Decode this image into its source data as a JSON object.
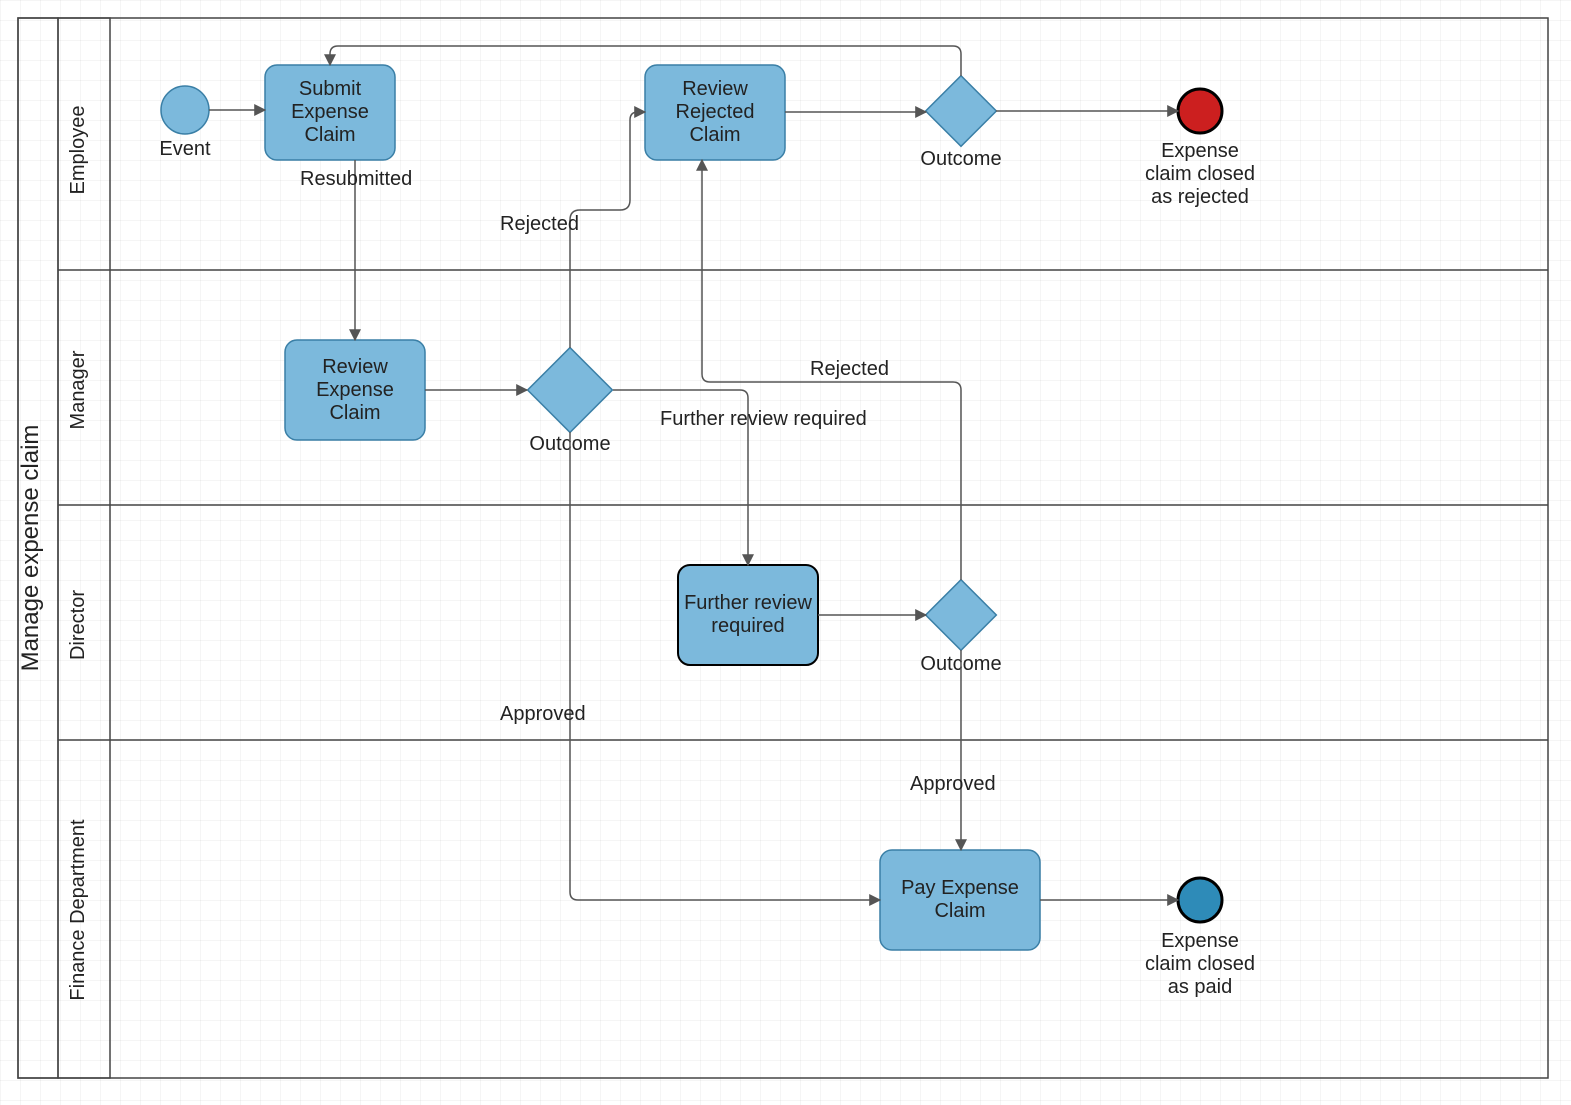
{
  "pool": {
    "title": "Manage expense claim"
  },
  "lanes": {
    "employee": "Employee",
    "manager": "Manager",
    "director": "Director",
    "finance": "Finance Department"
  },
  "nodes": {
    "start_label": "Event",
    "submit_claim": "Submit Expense Claim",
    "review_rejected": "Review Rejected Claim",
    "gw_employee_label": "Outcome",
    "end_rejected_label": "Expense claim closed as rejected",
    "review_claim": "Review Expense Claim",
    "gw_manager_label": "Outcome",
    "further_review": "Further review required",
    "gw_director_label": "Outcome",
    "pay_claim": "Pay Expense Claim",
    "end_paid_label": "Expense claim closed as paid"
  },
  "edges": {
    "resubmitted": "Resubmitted",
    "rejected": "Rejected",
    "rejected2": "Rejected",
    "further": "Further review required",
    "approved": "Approved",
    "approved2": "Approved"
  },
  "colors": {
    "task_fill": "#7cb9dc",
    "task_stroke": "#3a7fa6",
    "edge_stroke": "#555555",
    "end_red": "#cc1f1f",
    "end_blue": "#2e8bb8",
    "lane_stroke": "#444444"
  }
}
